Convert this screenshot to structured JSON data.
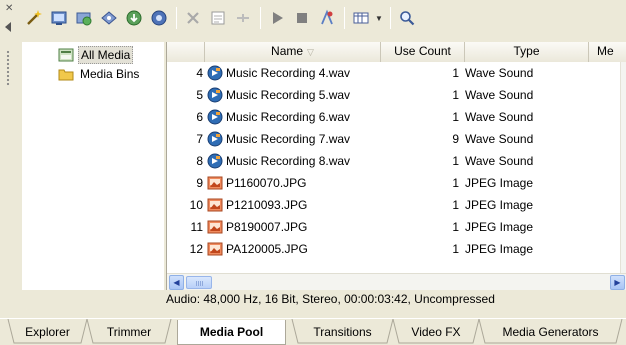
{
  "toolbar": {
    "buttons": [
      "wand-icon",
      "capture-video-icon",
      "get-media-web-icon",
      "burn-disc-icon",
      "import-media-icon",
      "media-fx-icon",
      "remove-media-icon",
      "properties-icon",
      "disabled-icon",
      "play-icon",
      "stop-icon",
      "auto-preview-icon",
      "views-icon",
      "search-icon"
    ]
  },
  "tree": {
    "items": [
      {
        "label": "All Media",
        "icon": "all-media-icon",
        "selected": true
      },
      {
        "label": "Media Bins",
        "icon": "folder-icon",
        "selected": false
      }
    ]
  },
  "grid": {
    "columns": {
      "name": "Name",
      "count": "Use Count",
      "type": "Type",
      "more": "Me"
    },
    "rows": [
      {
        "num": "4",
        "name": "Music Recording 4.wav",
        "count": "1",
        "type": "Wave Sound",
        "icon": "audio-file-icon"
      },
      {
        "num": "5",
        "name": "Music Recording 5.wav",
        "count": "1",
        "type": "Wave Sound",
        "icon": "audio-file-icon"
      },
      {
        "num": "6",
        "name": "Music Recording 6.wav",
        "count": "1",
        "type": "Wave Sound",
        "icon": "audio-file-icon"
      },
      {
        "num": "7",
        "name": "Music Recording 7.wav",
        "count": "9",
        "type": "Wave Sound",
        "icon": "audio-file-icon"
      },
      {
        "num": "8",
        "name": "Music Recording 8.wav",
        "count": "1",
        "type": "Wave Sound",
        "icon": "audio-file-icon"
      },
      {
        "num": "9",
        "name": "P1160070.JPG",
        "count": "1",
        "type": "JPEG Image",
        "icon": "image-file-icon"
      },
      {
        "num": "10",
        "name": "P1210093.JPG",
        "count": "1",
        "type": "JPEG Image",
        "icon": "image-file-icon"
      },
      {
        "num": "11",
        "name": "P8190007.JPG",
        "count": "1",
        "type": "JPEG Image",
        "icon": "image-file-icon"
      },
      {
        "num": "12",
        "name": "PA120005.JPG",
        "count": "1",
        "type": "JPEG Image",
        "icon": "image-file-icon"
      }
    ]
  },
  "status": {
    "text": "Audio: 48,000 Hz, 16 Bit, Stereo, 00:00:03:42, Uncompressed"
  },
  "tabs": [
    {
      "label": "Explorer",
      "active": false
    },
    {
      "label": "Trimmer",
      "active": false
    },
    {
      "label": "Media Pool",
      "active": true
    },
    {
      "label": "Transitions",
      "active": false
    },
    {
      "label": "Video FX",
      "active": false
    },
    {
      "label": "Media Generators",
      "active": false
    }
  ],
  "colors": {
    "window_bg": "#ece9d8",
    "accent_blue": "#316ac5",
    "grid_bg": "#ffffff"
  }
}
